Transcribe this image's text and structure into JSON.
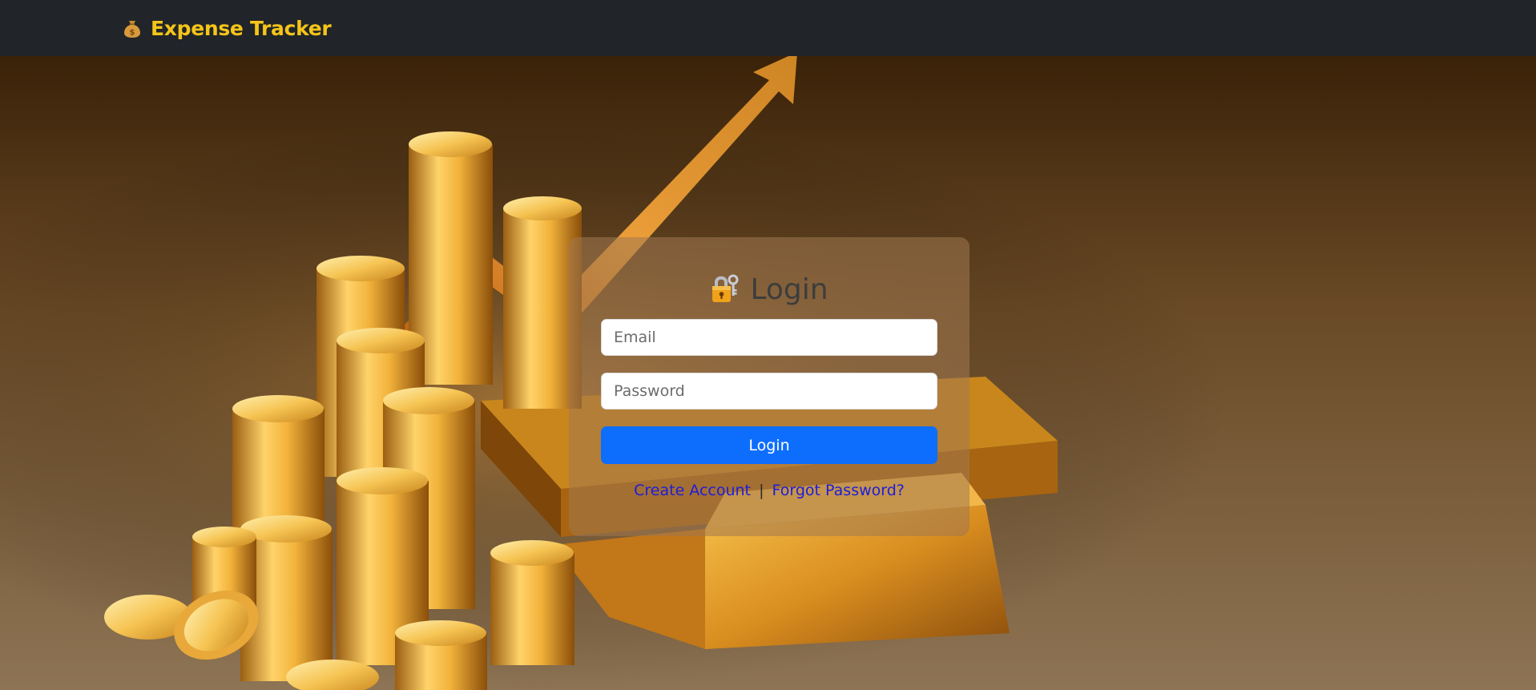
{
  "navbar": {
    "brand_icon": "money-bag-icon",
    "brand_text": "Expense Tracker",
    "brand_color": "#f5c518",
    "background": "#212529"
  },
  "login_card": {
    "title_icon": "lock-with-key-icon",
    "title": "Login",
    "email_placeholder": "Email",
    "email_value": "",
    "password_placeholder": "Password",
    "password_value": "",
    "login_button_label": "Login",
    "login_button_color": "#0d6efd",
    "create_account_label": "Create Account",
    "separator": "|",
    "forgot_password_label": "Forgot Password?",
    "link_color": "#1d1dd8"
  },
  "background": {
    "image": "gold-coins-and-bars-with-rising-arrow"
  }
}
